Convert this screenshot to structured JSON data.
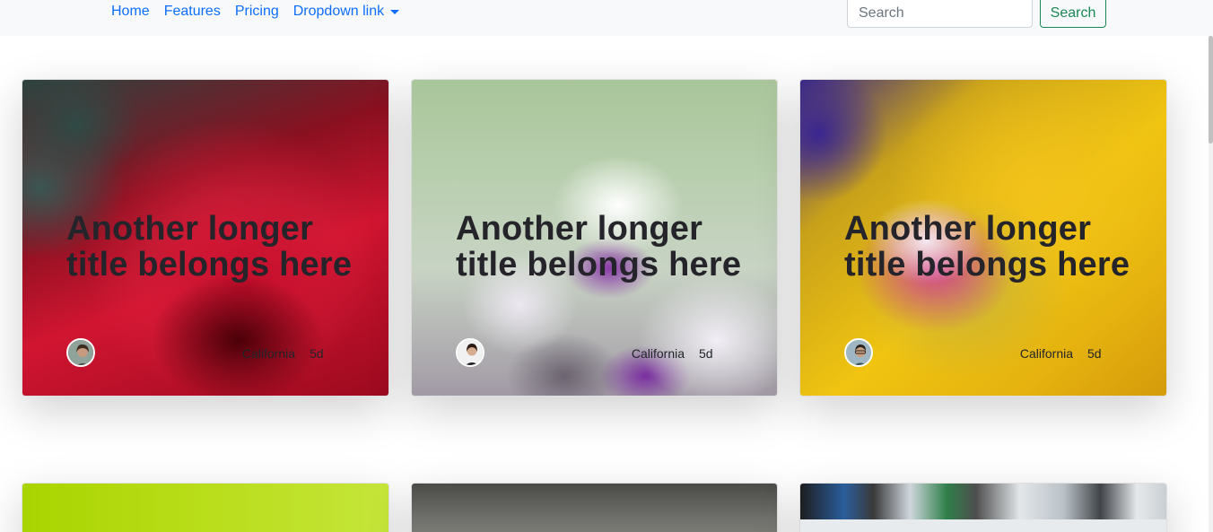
{
  "navbar": {
    "links": [
      {
        "label": "Home"
      },
      {
        "label": "Features"
      },
      {
        "label": "Pricing"
      },
      {
        "label": "Dropdown link"
      }
    ],
    "search": {
      "placeholder": "Search",
      "button_label": "Search"
    }
  },
  "cards": [
    {
      "title": "Another longer title belongs here",
      "location": "California",
      "days": "5d",
      "image": "red-rose-photo"
    },
    {
      "title": "Another longer title belongs here",
      "location": "California",
      "days": "5d",
      "image": "white-purple-blossom-photo"
    },
    {
      "title": "Another longer title belongs here",
      "location": "California",
      "days": "5d",
      "image": "yellow-flower-macro-photo"
    },
    {
      "image": "green-gradient-photo"
    },
    {
      "image": "gray-blurred-photo"
    },
    {
      "image": "street-scene-photo"
    }
  ],
  "colors": {
    "link": "#0d6efd",
    "success": "#198754",
    "navbar_bg": "#f8f9fa"
  }
}
